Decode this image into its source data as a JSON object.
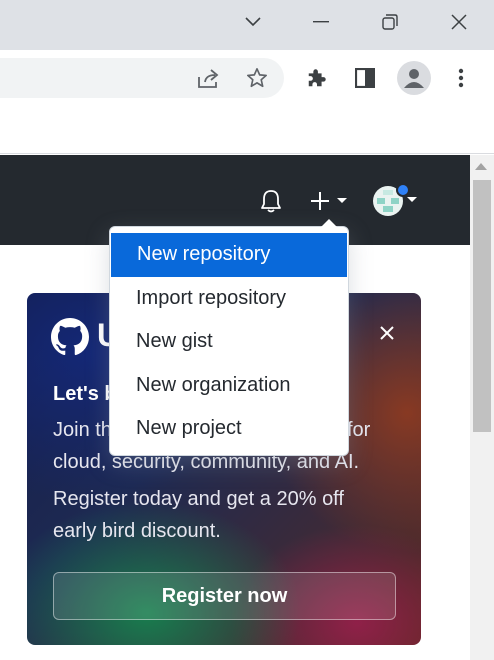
{
  "browser": {
    "window_controls": [
      "tab-search",
      "minimize",
      "restore",
      "close"
    ],
    "toolbar_icons": [
      "share-icon",
      "bookmark-star-icon",
      "extensions-icon",
      "side-panel-icon",
      "profile-icon",
      "menu-kebab-icon"
    ]
  },
  "github_header": {
    "icons": [
      "bell-icon",
      "plus-icon",
      "avatar"
    ]
  },
  "menu": {
    "items": [
      {
        "label": "New repository",
        "active": true
      },
      {
        "label": "Import repository",
        "active": false
      },
      {
        "label": "New gist",
        "active": false
      },
      {
        "label": "New organization",
        "active": false
      },
      {
        "label": "New project",
        "active": false
      }
    ]
  },
  "promo": {
    "title_partial": "U",
    "heading_partial": "Let's b",
    "line1_partial_left": "Join th",
    "line1_partial_right": "for",
    "line2": "cloud, security, community, and AI.",
    "line3": "Register today and get a 20% off",
    "line4": "early bird discount.",
    "button_label": "Register now"
  },
  "colors": {
    "header_bg": "#24292f",
    "menu_active_bg": "#0969da",
    "notification_dot": "#2f81f7"
  }
}
